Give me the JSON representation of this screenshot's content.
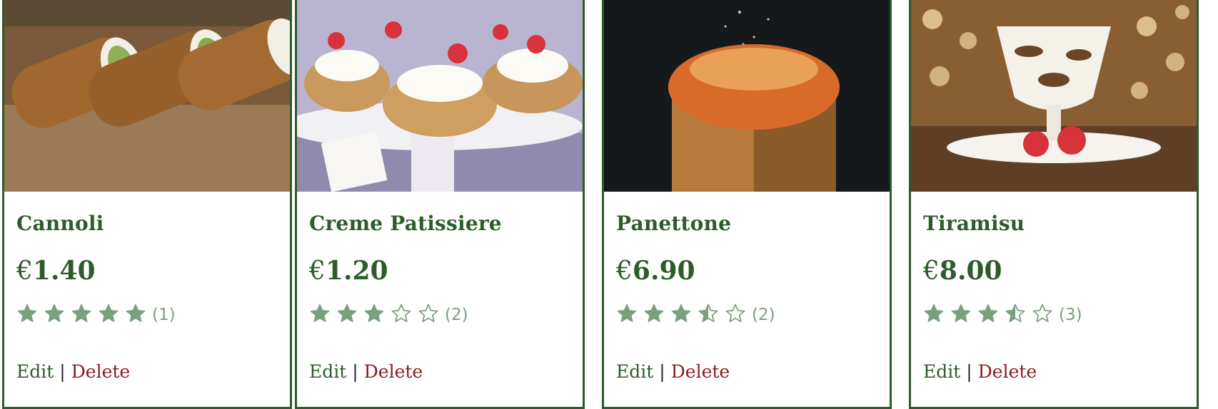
{
  "colors": {
    "brand_green": "#2e5b2a",
    "star_green": "#7aa07d",
    "delete_red": "#8b1a1a"
  },
  "currency_symbol": "€",
  "actions": {
    "edit": "Edit",
    "separator": "|",
    "delete": "Delete"
  },
  "products": [
    {
      "name": "Cannoli",
      "price": "1.40",
      "rating": 5,
      "rating_count": "(1)",
      "image": "cannoli-photo"
    },
    {
      "name": "Creme Patissiere",
      "price": "1.20",
      "rating": 3,
      "rating_count": "(2)",
      "image": "cream-puffs-photo"
    },
    {
      "name": "Panettone",
      "price": "6.90",
      "rating": 3.5,
      "rating_count": "(2)",
      "image": "panettone-photo"
    },
    {
      "name": "Tiramisu",
      "price": "8.00",
      "rating": 3.5,
      "rating_count": "(3)",
      "image": "tiramisu-photo"
    }
  ]
}
